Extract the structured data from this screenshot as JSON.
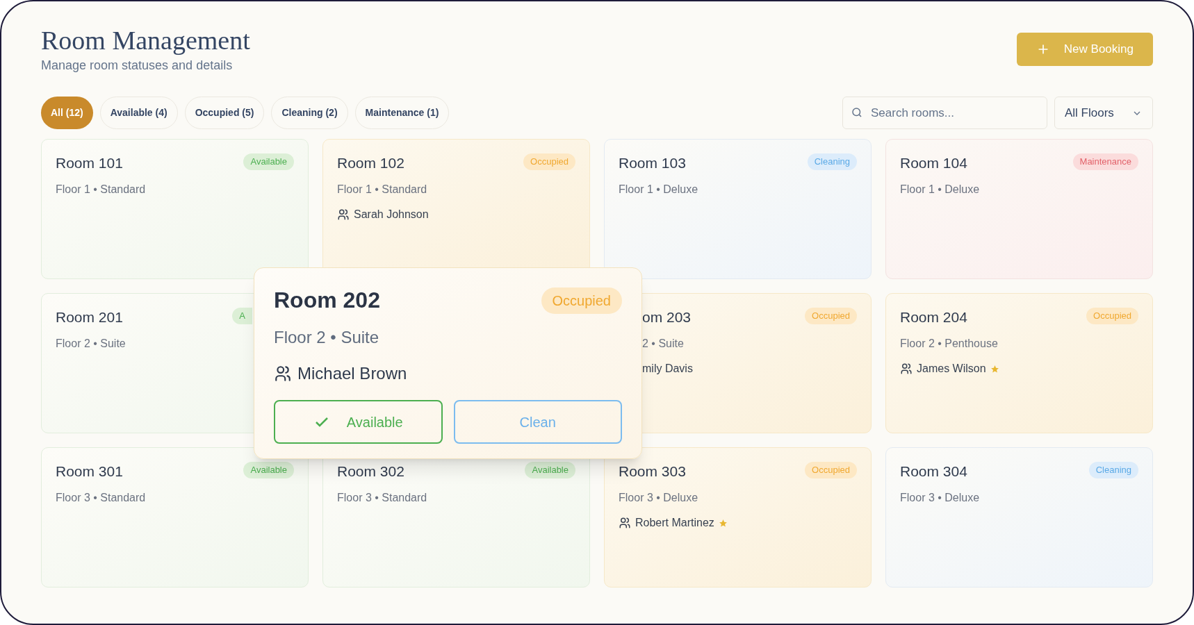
{
  "header": {
    "title": "Room Management",
    "subtitle": "Manage room statuses and details",
    "new_booking": "New Booking"
  },
  "filters": [
    {
      "label": "All (12)",
      "selected": true
    },
    {
      "label": "Available (4)",
      "selected": false
    },
    {
      "label": "Occupied (5)",
      "selected": false
    },
    {
      "label": "Cleaning (2)",
      "selected": false
    },
    {
      "label": "Maintenance (1)",
      "selected": false
    }
  ],
  "search": {
    "placeholder": "Search rooms..."
  },
  "floor_select": {
    "value": "All Floors"
  },
  "rooms": [
    {
      "name": "Room 101",
      "kind": "available",
      "badge": "Available",
      "details": "Floor 1 • Standard"
    },
    {
      "name": "Room 102",
      "kind": "occupied",
      "badge": "Occupied",
      "details": "Floor 1 • Standard",
      "guest": {
        "name": "Sarah Johnson",
        "vip": false
      }
    },
    {
      "name": "Room 103",
      "kind": "cleaning",
      "badge": "Cleaning",
      "details": "Floor 1 • Deluxe"
    },
    {
      "name": "Room 104",
      "kind": "maintenance",
      "badge": "Maintenance",
      "details": "Floor 1 • Deluxe"
    },
    {
      "name": "Room 201",
      "kind": "available",
      "badge": "A",
      "badge_cut": true,
      "details": "Floor 2 • Suite"
    },
    {
      "name": "Room 202",
      "kind": "occupied",
      "expanded": true,
      "badge": "Occupied",
      "details": "Floor 2 • Suite",
      "guest": {
        "name": "Michael Brown",
        "vip": false
      },
      "actions": [
        {
          "kind": "available",
          "label": "Available"
        },
        {
          "kind": "clean",
          "label": "Clean"
        }
      ]
    },
    {
      "name": "om 203",
      "kind": "occupied",
      "badge": "Occupied",
      "details": "2 • Suite",
      "left_cut": true,
      "guest": {
        "name": "mily Davis",
        "vip": false,
        "icon_hidden": true
      }
    },
    {
      "name": "Room 204",
      "kind": "occupied",
      "badge": "Occupied",
      "details": "Floor 2 • Penthouse",
      "guest": {
        "name": "James Wilson",
        "vip": true
      }
    },
    {
      "name": "Room 301",
      "kind": "available",
      "badge": "Available",
      "details": "Floor 3 • Standard"
    },
    {
      "name": "Room 302",
      "kind": "available",
      "badge": "Available",
      "details": "Floor 3 • Standard"
    },
    {
      "name": "Room 303",
      "kind": "occupied",
      "badge": "Occupied",
      "details": "Floor 3 • Deluxe",
      "guest": {
        "name": "Robert Martinez",
        "vip": true
      }
    },
    {
      "name": "Room 304",
      "kind": "cleaning",
      "badge": "Cleaning",
      "details": "Floor 3 • Deluxe"
    }
  ]
}
